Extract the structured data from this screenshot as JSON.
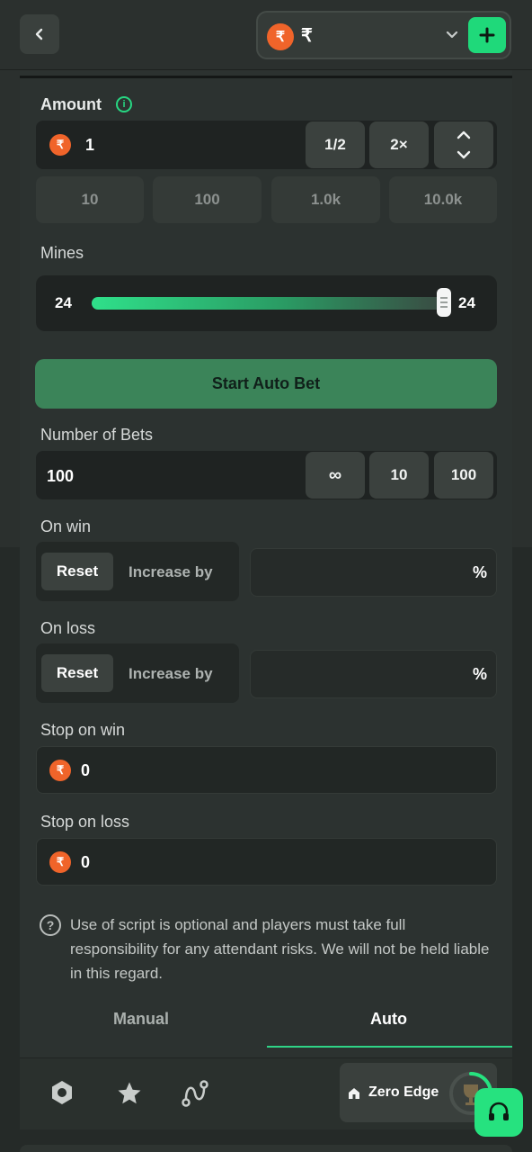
{
  "header": {
    "currency_symbol": "₹",
    "coin_symbol": "₹"
  },
  "amount": {
    "label": "Amount",
    "value": "1",
    "half_label": "1/2",
    "double_label": "2×",
    "quick_values": [
      "10",
      "100",
      "1.0k",
      "10.0k"
    ]
  },
  "mines": {
    "label": "Mines",
    "min_value": "24",
    "max_value": "24",
    "level": 1.0
  },
  "start_button": "Start Auto Bet",
  "number_of_bets": {
    "label": "Number of Bets",
    "value": "100",
    "options": [
      "∞",
      "10",
      "100"
    ]
  },
  "on_win": {
    "label": "On win",
    "reset": "Reset",
    "increase": "Increase by",
    "unit": "%"
  },
  "on_loss": {
    "label": "On loss",
    "reset": "Reset",
    "increase": "Increase by",
    "unit": "%"
  },
  "stop_on_win": {
    "label": "Stop on win",
    "value": "0"
  },
  "stop_on_loss": {
    "label": "Stop on loss",
    "value": "0"
  },
  "notice": "Use of script is optional and players must take full responsibility for any attendant risks. We will not be held liable in this regard.",
  "tabs": {
    "manual": "Manual",
    "auto": "Auto",
    "active": "auto"
  },
  "zero_edge": "Zero Edge",
  "colors": {
    "accent": "#1fd97a",
    "start_button": "#3b8459",
    "coin": "#f0642a"
  }
}
